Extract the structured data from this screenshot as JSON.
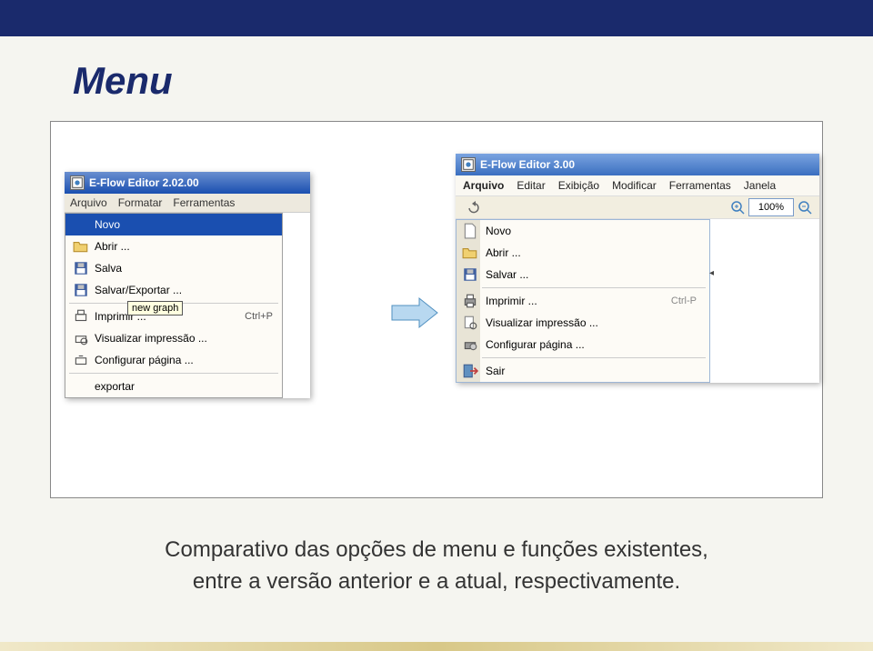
{
  "slide": {
    "title": "Menu",
    "caption": "Comparativo das opções de menu e funções existentes, entre a versão anterior e a atual, respectivamente."
  },
  "left_app": {
    "title": "E-Flow Editor 2.02.00",
    "menubar": [
      "Arquivo",
      "Formatar",
      "Ferramentas"
    ],
    "tooltip": "new graph",
    "menu": {
      "novo": "Novo",
      "abrir": "Abrir ...",
      "salvar": "Salva",
      "salvar_exportar": "Salvar/Exportar ...",
      "imprimir": "Imprimir ...",
      "imprimir_shortcut": "Ctrl+P",
      "visualizar": "Visualizar impressão ...",
      "configurar": "Configurar página ...",
      "exportar": "exportar"
    }
  },
  "right_app": {
    "title": "E-Flow Editor 3.00",
    "menubar": [
      "Arquivo",
      "Editar",
      "Exibição",
      "Modificar",
      "Ferramentas",
      "Janela"
    ],
    "zoom": "100%",
    "menu": {
      "novo": "Novo",
      "abrir": "Abrir ...",
      "salvar": "Salvar ...",
      "imprimir": "Imprimir ...",
      "imprimir_shortcut": "Ctrl-P",
      "visualizar": "Visualizar impressão ...",
      "configurar": "Configurar página ...",
      "sair": "Sair"
    }
  }
}
